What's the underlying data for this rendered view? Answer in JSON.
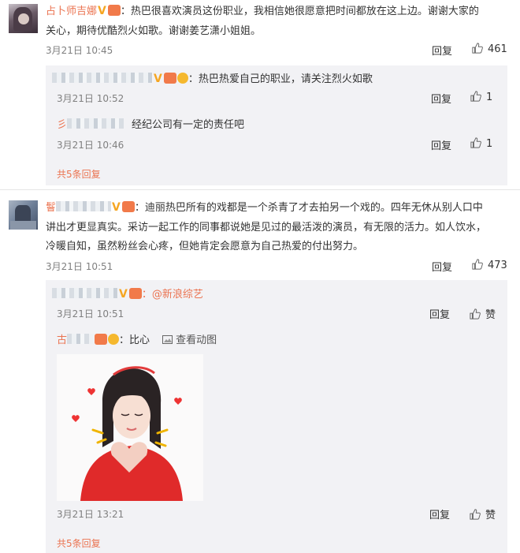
{
  "comments": [
    {
      "user": "占卜师吉娜",
      "text": "：热巴很喜欢演员这份职业，我相信她很愿意把时间都放在这上边。谢谢大家的",
      "text2": "关心，期待优酷烈火如歌。谢谢姜艺潇小姐姐。",
      "time": "3月21日 10:45",
      "reply": "回复",
      "likes": "461",
      "replies": [
        {
          "text": "：热巴热爱自己的职业，请关注烈火如歌",
          "time": "3月21日 10:52",
          "reply": "回复",
          "likes": "1"
        },
        {
          "user_prefix": "彡",
          "text": "经纪公司有一定的责任吧",
          "time": "3月21日 10:46",
          "reply": "回复",
          "likes": "1"
        }
      ],
      "more": "共5条回复"
    },
    {
      "user_prefix": "鬙",
      "text": "：迪丽热巴所有的戏都是一个杀青了才去拍另一个戏的。四年无休从别人口中",
      "text2": "讲出才更显真实。采访一起工作的同事都说她是见过的最活泼的演员，有无限的活力。如人饮水，",
      "text3": "冷暖自知，虽然粉丝会心疼，但她肯定会愿意为自己热爱的付出努力。",
      "time": "3月21日 10:51",
      "reply": "回复",
      "likes": "473",
      "replies": [
        {
          "text": "：@新浪综艺",
          "time": "3月21日 10:51",
          "reply": "回复",
          "likes": "赞"
        },
        {
          "user_prefix": "古",
          "text": "：比心",
          "gif": "查看动图",
          "time": "3月21日 13:21",
          "reply": "回复",
          "likes": "赞"
        }
      ],
      "more": "共5条回复"
    }
  ]
}
